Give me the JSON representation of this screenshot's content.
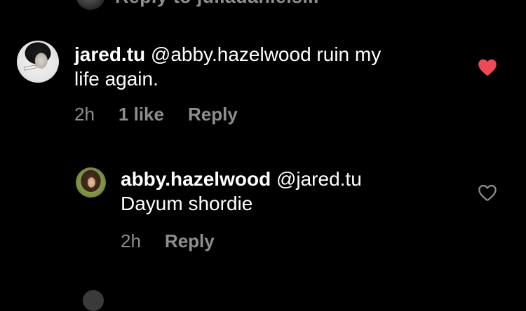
{
  "top_partial": {
    "text": "Reply to juliadaniels..."
  },
  "comments": [
    {
      "username": "jared.tu",
      "text": " @abby.hazelwood ruin my",
      "text_line2": "life again.",
      "time": "2h",
      "likes": "1 like",
      "reply_label": "Reply",
      "liked": true,
      "heart_icon": "heart-filled-icon",
      "heart_color": "#ed4956"
    },
    {
      "username": "abby.hazelwood",
      "text": " @jared.tu",
      "text_line2": "Dayum shordie",
      "time": "2h",
      "reply_label": "Reply",
      "liked": false,
      "heart_icon": "heart-outline-icon",
      "heart_color": "#8e8e8e"
    }
  ],
  "colors": {
    "background": "#000000",
    "primary_text": "#ffffff",
    "secondary_text": "#8e8e8e",
    "like_red": "#ed4956"
  }
}
